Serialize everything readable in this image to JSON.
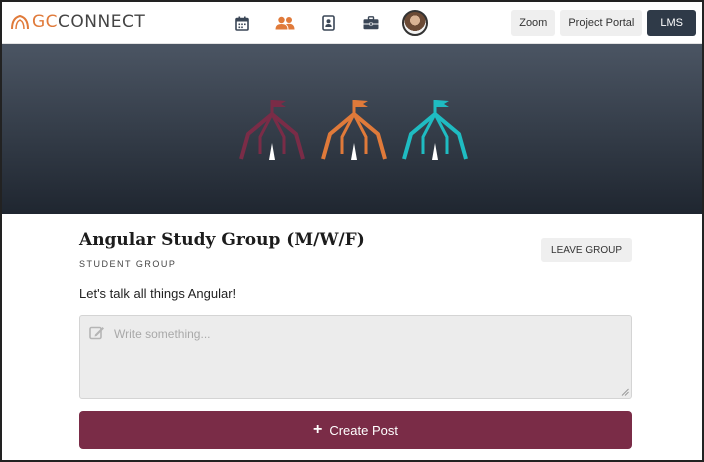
{
  "header": {
    "logo_prefix": "GC",
    "logo_suffix": "CONNECT",
    "nav_icons": [
      "calendar-icon",
      "people-icon",
      "contact-card-icon",
      "briefcase-icon"
    ],
    "buttons": {
      "zoom": "Zoom",
      "portal": "Project Portal",
      "lms": "LMS"
    }
  },
  "group": {
    "name": "Angular Study Group (M/W/F)",
    "type": "STUDENT GROUP",
    "description": "Let's talk all things Angular!",
    "leave_label": "LEAVE GROUP"
  },
  "composer": {
    "placeholder": "Write something...",
    "submit_label": "Create Post"
  },
  "colors": {
    "accent_orange": "#e07a3a",
    "maroon": "#7a2c47",
    "teal": "#1fbcc2",
    "dark_button": "#2f3a48"
  }
}
